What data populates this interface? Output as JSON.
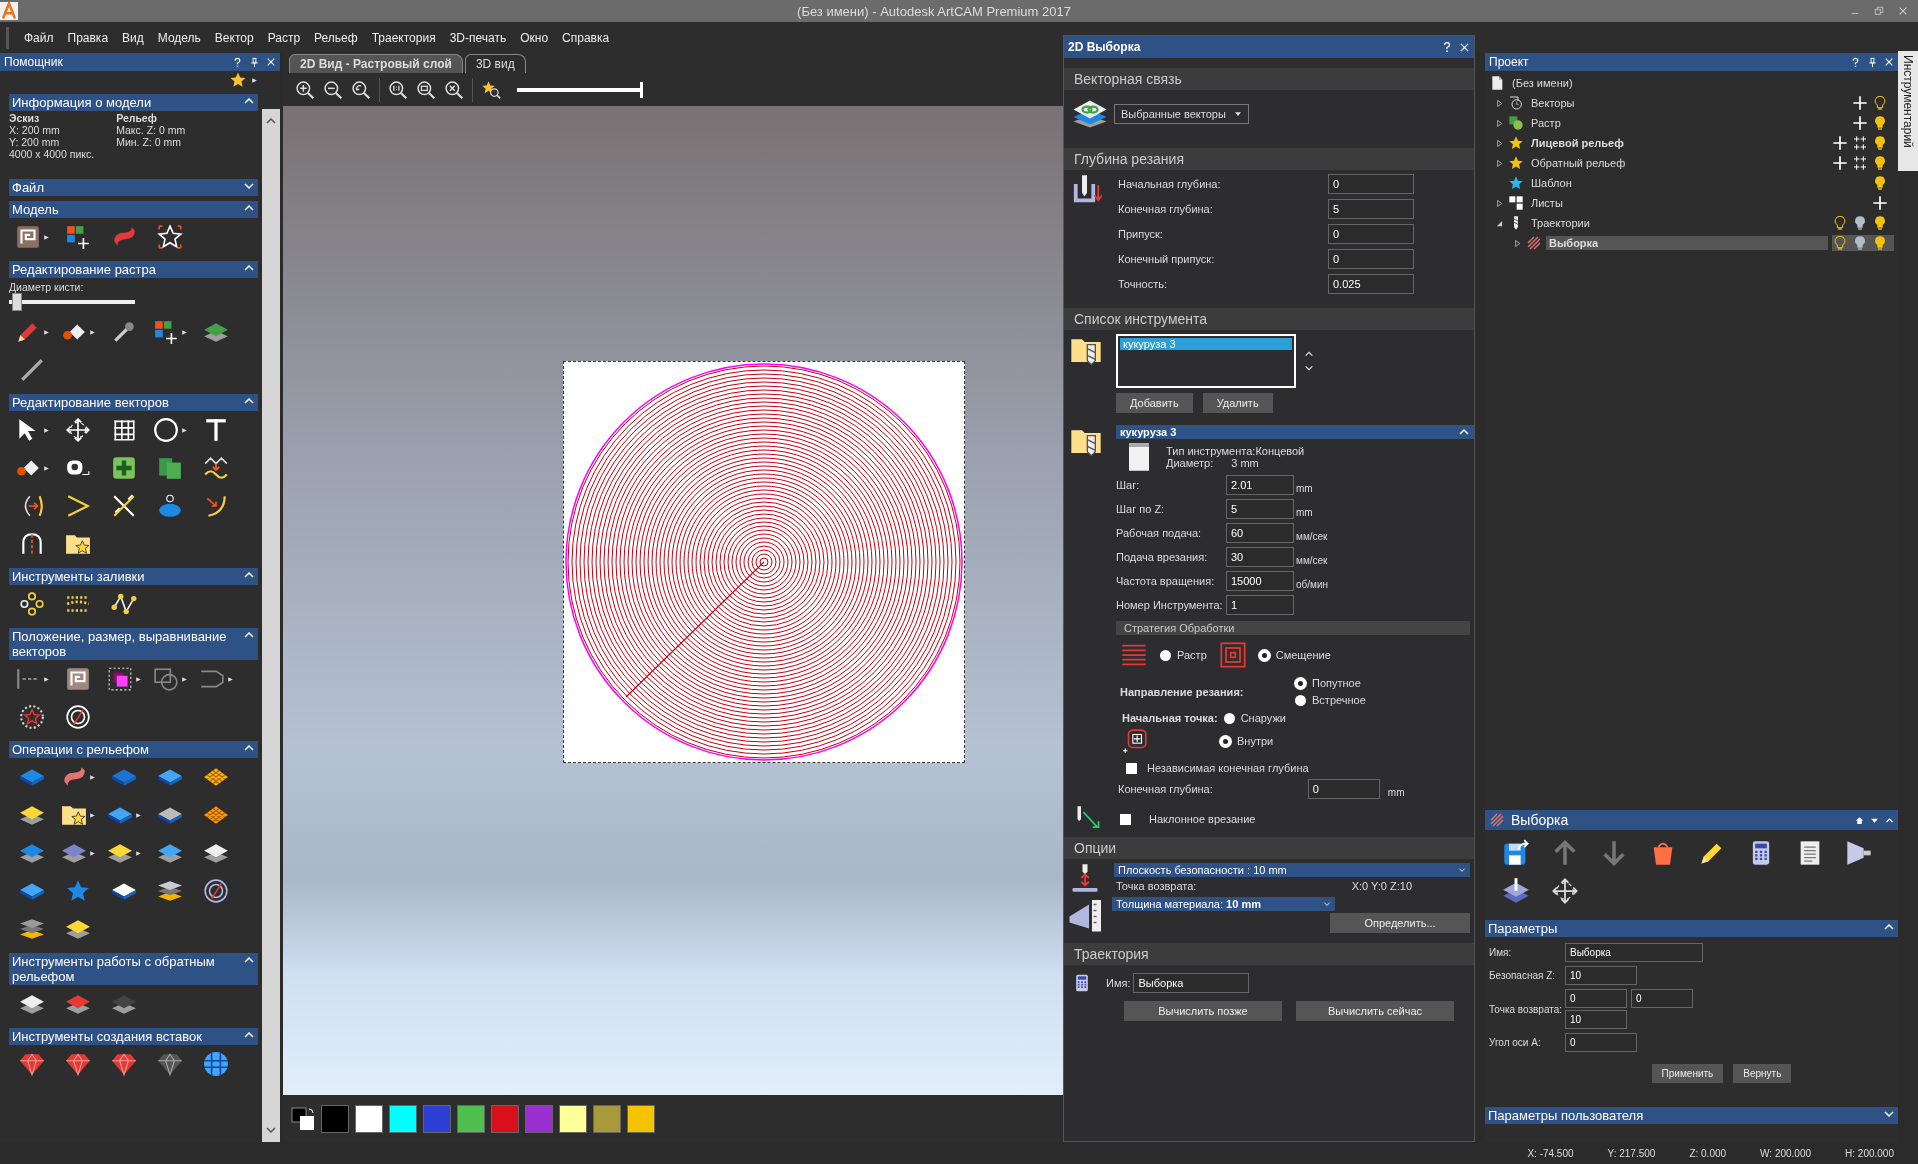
{
  "window": {
    "title": "(Без имени) - Autodesk ArtCAM Premium 2017"
  },
  "menu": [
    "Файл",
    "Правка",
    "Вид",
    "Модель",
    "Вектор",
    "Растр",
    "Рельеф",
    "Траектория",
    "3D-печать",
    "Окно",
    "Справка"
  ],
  "assistant": {
    "title": "Помощник",
    "model_info": {
      "title": "Информация о модели",
      "expanded": true,
      "sketch_heading": "Эскиз",
      "sketch_lines": [
        "X: 200 mm",
        "Y: 200 mm",
        "4000 x 4000 пикс."
      ],
      "relief_heading": "Рельеф",
      "relief_lines": [
        "Макс. Z: 0 mm",
        "Мин. Z: 0 mm"
      ]
    },
    "sections": [
      {
        "title": "Файл",
        "expanded": false
      },
      {
        "title": "Модель",
        "expanded": true,
        "kind": "model"
      },
      {
        "title": "Редактирование растра",
        "expanded": true,
        "kind": "raster",
        "slider": {
          "label": "Диаметр кисти:",
          "level": 0.03
        }
      },
      {
        "title": "Редактирование векторов",
        "expanded": true,
        "kind": "vector"
      },
      {
        "title": "Инструменты заливки",
        "expanded": true,
        "kind": "fill"
      },
      {
        "title": "Положение, размер, выравнивание векторов",
        "expanded": true,
        "kind": "position"
      },
      {
        "title": "Операции с рельефом",
        "expanded": true,
        "kind": "relief"
      },
      {
        "title": "Инструменты работы с обратным рельефом",
        "expanded": true,
        "kind": "reverse"
      },
      {
        "title": "Инструменты создания вставок",
        "expanded": true,
        "kind": "inlay"
      }
    ]
  },
  "view": {
    "tabs": [
      {
        "label": "2D Вид - Растровый слой",
        "selected": true
      },
      {
        "label": "3D вид",
        "selected": false
      }
    ],
    "zoom_slider": {
      "level": 1
    },
    "palette": [
      {
        "color": "#000000"
      },
      {
        "color": "#ffffff"
      },
      {
        "color": "#00ffff"
      },
      {
        "color": "#2e3fd6"
      },
      {
        "color": "#4fbf4f"
      },
      {
        "color": "#d7101c"
      },
      {
        "color": "#9a2fd0"
      },
      {
        "color": "#ffff99"
      },
      {
        "color": "#a89a3a"
      },
      {
        "color": "#f5c400"
      }
    ]
  },
  "pocket": {
    "title": "2D Выборка",
    "vector_link": {
      "heading": "Векторная связь",
      "dropdown": "Выбранные векторы"
    },
    "depth": {
      "heading": "Глубина резания",
      "fields": [
        {
          "label": "Начальная глубина:",
          "value": "0"
        },
        {
          "label": "Конечная глубина:",
          "value": "5"
        },
        {
          "label": "Припуск:",
          "value": "0"
        },
        {
          "label": "Конечный припуск:",
          "value": "0"
        },
        {
          "label": "Точность:",
          "value": "0.025"
        }
      ]
    },
    "tool_list": {
      "heading": "Список инструмента",
      "items": [
        {
          "label": "кукуруза 3",
          "selected": true
        }
      ],
      "buttons": [
        "Добавить",
        "Удалить"
      ]
    },
    "tool": {
      "name": "кукуруза 3",
      "expanded": true,
      "type_label": "Тип инструмента:",
      "type_value": "Концевой",
      "diameter_label": "Диаметр:",
      "diameter_value": "3 mm",
      "fields": [
        {
          "label": "Шаг:",
          "value": "2.01",
          "unit": "mm"
        },
        {
          "label": "Шаг по Z:",
          "value": "5",
          "unit": "mm"
        },
        {
          "label": "Рабочая подача:",
          "value": "60",
          "unit": "мм/сек"
        },
        {
          "label": "Подача врезания:",
          "value": "30",
          "unit": "мм/сек"
        },
        {
          "label": "Частота вращения:",
          "value": "15000",
          "unit": "об/мин"
        },
        {
          "label": "Номер Инструмента:",
          "value": "1"
        }
      ]
    },
    "strategy": {
      "heading": "Стратегия Обработки",
      "options": [
        {
          "label": "Растр",
          "kind": "raster",
          "selected": false
        },
        {
          "label": "Смещение",
          "kind": "offset",
          "selected": true
        }
      ]
    },
    "direction": {
      "label": "Направление резания:",
      "options": [
        {
          "label": "Попутное",
          "selected": true
        },
        {
          "label": "Встречное",
          "selected": false
        }
      ]
    },
    "start_point": {
      "label": "Начальная точка:",
      "options": [
        {
          "label": "Снаружи",
          "selected": false
        },
        {
          "label": "Внутри",
          "selected": true
        }
      ]
    },
    "independent_depth": {
      "label": "Независимая конечная глубина",
      "checked": false
    },
    "final_depth": {
      "label": "Конечная глубина:",
      "value": "0",
      "unit": "mm"
    },
    "ramp": {
      "label": "Наклонное врезание",
      "checked": false
    },
    "options": {
      "heading": "Опции",
      "safe_plane": "Плоскость безопасности : 10 mm",
      "home_label": "Точка возврата:",
      "home_value": "X:0 Y:0 Z:10",
      "material": "Толщина материала: **10 mm**",
      "define_button": "Определить..."
    },
    "toolpath": {
      "heading": "Траектория",
      "name_label": "Имя:",
      "name_value": "Выборка",
      "buttons": [
        "Вычислить позже",
        "Вычислить сейчас"
      ]
    }
  },
  "project": {
    "title": "Проект",
    "root": {
      "label": "(Без имени)",
      "children": [
        {
          "label": "Векторы",
          "kind": "vectors",
          "expanded": false,
          "selected": false,
          "active": false
        },
        {
          "label": "Растр",
          "kind": "raster",
          "expanded": false,
          "selected": false,
          "active": false
        },
        {
          "label": "Лицевой рельеф",
          "kind": "relief",
          "expanded": false,
          "selected": false,
          "active": true
        },
        {
          "label": "Обратный рельеф",
          "kind": "relief",
          "expanded": false,
          "selected": false,
          "active": false
        },
        {
          "label": "Шаблон",
          "kind": "template",
          "selected": false,
          "active": false
        },
        {
          "label": "Листы",
          "kind": "sheets",
          "expanded": false,
          "selected": false,
          "active": false
        },
        {
          "label": "Траектории",
          "kind": "toolpaths",
          "expanded": true,
          "selected": false,
          "active": false,
          "children": [
            {
              "label": "Выборка",
              "kind": "toolpath",
              "expanded": false,
              "selected": true,
              "active": true
            }
          ]
        }
      ]
    }
  },
  "toolpath_panel": {
    "title": "Выборка",
    "parameters": {
      "heading": "Параметры",
      "expanded": true,
      "name_label": "Имя:",
      "name_value": "Выборка",
      "safe_z_label": "Безопасная Z:",
      "safe_z_value": "10",
      "home_label": "Точка возврата:",
      "home_values": [
        "0",
        "0",
        "10"
      ],
      "angle_label": "Угол оси A:",
      "angle_value": "0",
      "buttons": [
        "Применить",
        "Вернуть"
      ]
    },
    "user_parameters": {
      "heading": "Параметры пользователя",
      "expanded": false
    }
  },
  "side_tab": {
    "label": "Инструментарий"
  },
  "status_bar": [
    "X: -74.500",
    "Y: 217.500",
    "Z: 0.000",
    "W: 200.000",
    "H: 200.000"
  ]
}
